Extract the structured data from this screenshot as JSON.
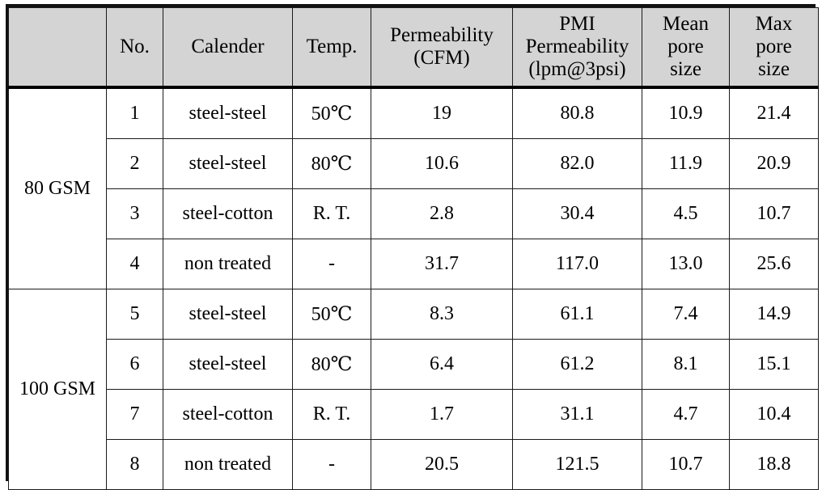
{
  "table": {
    "columns": [
      {
        "key": "gsm",
        "label": ""
      },
      {
        "key": "no",
        "label": "No."
      },
      {
        "key": "cal",
        "label": "Calender"
      },
      {
        "key": "temp",
        "label": "Temp."
      },
      {
        "key": "perm",
        "label_line1": "Permeability",
        "label_line2": "(CFM)"
      },
      {
        "key": "pmi",
        "label_line1": "PMI",
        "label_line2": "Permeability",
        "label_line3": "(lpm@3psi)"
      },
      {
        "key": "mean",
        "label_line1": "Mean",
        "label_line2": "pore",
        "label_line3": "size"
      },
      {
        "key": "max",
        "label_line1": "Max",
        "label_line2": "pore",
        "label_line3": "size"
      }
    ],
    "groups": [
      {
        "label": "80 GSM",
        "rows": [
          {
            "no": "1",
            "calender": "steel-steel",
            "temp": "50℃",
            "permeability": "19",
            "pmi": "80.8",
            "mean_pore": "10.9",
            "max_pore": "21.4"
          },
          {
            "no": "2",
            "calender": "steel-steel",
            "temp": "80℃",
            "permeability": "10.6",
            "pmi": "82.0",
            "mean_pore": "11.9",
            "max_pore": "20.9"
          },
          {
            "no": "3",
            "calender": "steel-cotton",
            "temp": "R. T.",
            "permeability": "2.8",
            "pmi": "30.4",
            "mean_pore": "4.5",
            "max_pore": "10.7"
          },
          {
            "no": "4",
            "calender": "non  treated",
            "temp": "-",
            "permeability": "31.7",
            "pmi": "117.0",
            "mean_pore": "13.0",
            "max_pore": "25.6"
          }
        ]
      },
      {
        "label": "100 GSM",
        "rows": [
          {
            "no": "5",
            "calender": "steel-steel",
            "temp": "50℃",
            "permeability": "8.3",
            "pmi": "61.1",
            "mean_pore": "7.4",
            "max_pore": "14.9"
          },
          {
            "no": "6",
            "calender": "steel-steel",
            "temp": "80℃",
            "permeability": "6.4",
            "pmi": "61.2",
            "mean_pore": "8.1",
            "max_pore": "15.1"
          },
          {
            "no": "7",
            "calender": "steel-cotton",
            "temp": "R. T.",
            "permeability": "1.7",
            "pmi": "31.1",
            "mean_pore": "4.7",
            "max_pore": "10.4"
          },
          {
            "no": "8",
            "calender": "non  treated",
            "temp": "-",
            "permeability": "20.5",
            "pmi": "121.5",
            "mean_pore": "10.7",
            "max_pore": "18.8"
          }
        ]
      }
    ]
  },
  "colors": {
    "header_background": "#d4d4d4",
    "body_background": "#ffffff",
    "border": "#1a1a1a",
    "text": "#000000"
  }
}
